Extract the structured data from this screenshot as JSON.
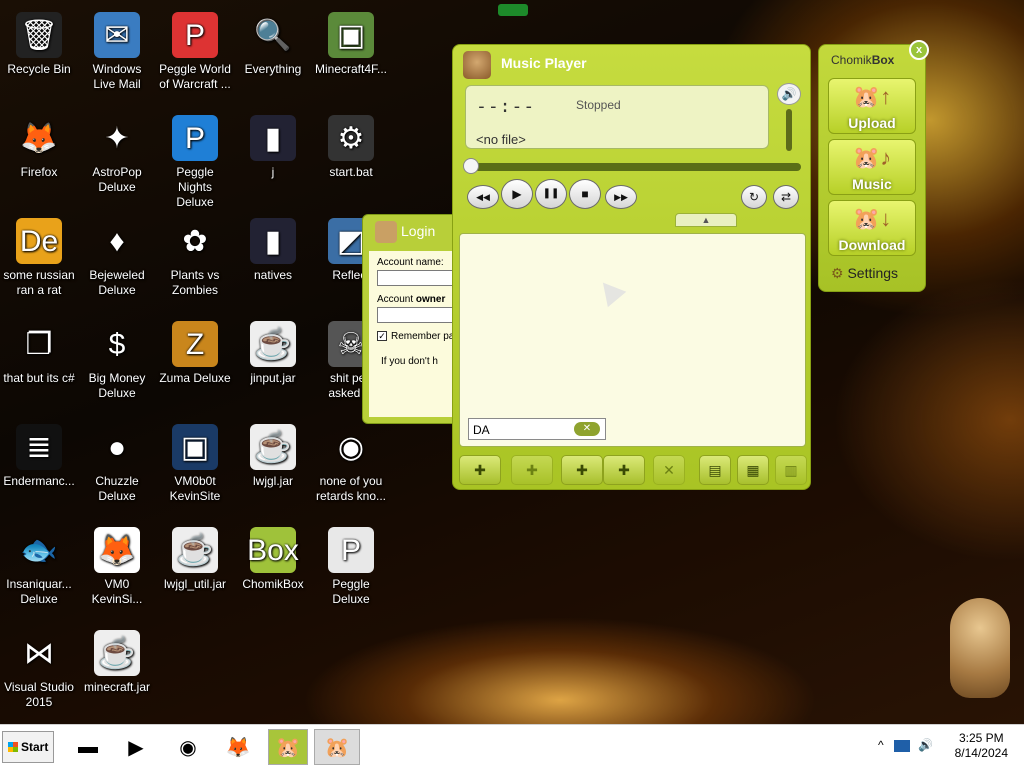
{
  "desktop_icons": [
    {
      "label": "Recycle Bin",
      "icon": "recycle-bin-icon",
      "glyph": "🗑",
      "bg": "#222"
    },
    {
      "label": "Windows Live Mail",
      "icon": "mail-icon",
      "glyph": "✉",
      "bg": "#3a7cc1"
    },
    {
      "label": "Peggle World of Warcraft ...",
      "icon": "peggle-icon",
      "glyph": "P",
      "bg": "#d33"
    },
    {
      "label": "Everything",
      "icon": "search-icon",
      "glyph": "🔍",
      "bg": "transparent"
    },
    {
      "label": "Minecraft4F...",
      "icon": "minecraft-icon",
      "glyph": "▣",
      "bg": "#5b8a3a"
    },
    {
      "label": "Firefox",
      "icon": "firefox-icon",
      "glyph": "🦊",
      "bg": "transparent"
    },
    {
      "label": "AstroPop Deluxe",
      "icon": "astropop-icon",
      "glyph": "✦",
      "bg": "transparent"
    },
    {
      "label": "Peggle Nights Deluxe",
      "icon": "peggle-nights-icon",
      "glyph": "P",
      "bg": "#1f7fd6"
    },
    {
      "label": "j",
      "icon": "folder-icon",
      "glyph": "▮",
      "bg": "#223"
    },
    {
      "label": "start.bat",
      "icon": "batch-file-icon",
      "glyph": "⚙",
      "bg": "#333"
    },
    {
      "label": "some russian ran a rat",
      "icon": "de-icon",
      "glyph": "De",
      "bg": "#e9a21a"
    },
    {
      "label": "Bejeweled Deluxe",
      "icon": "gem-icon",
      "glyph": "♦",
      "bg": "transparent"
    },
    {
      "label": "Plants vs Zombies",
      "icon": "pvz-icon",
      "glyph": "✿",
      "bg": "transparent"
    },
    {
      "label": "natives",
      "icon": "folder-icon",
      "glyph": "▮",
      "bg": "#223"
    },
    {
      "label": "Reflect",
      "icon": "reflect-icon",
      "glyph": "◩",
      "bg": "#3b6ea5"
    },
    {
      "label": "that but its c#",
      "icon": "copy-icon",
      "glyph": "❐",
      "bg": "transparent"
    },
    {
      "label": "Big Money Deluxe",
      "icon": "money-bag-icon",
      "glyph": "$",
      "bg": "transparent"
    },
    {
      "label": "Zuma Deluxe",
      "icon": "zuma-icon",
      "glyph": "Z",
      "bg": "#c9861c"
    },
    {
      "label": "jinput.jar",
      "icon": "jar-file-icon",
      "glyph": "☕",
      "bg": "#eee"
    },
    {
      "label": "shit ped asked m",
      "icon": "file-icon",
      "glyph": "☠",
      "bg": "#555"
    },
    {
      "label": "Endermanc...",
      "icon": "console-icon",
      "glyph": "≣",
      "bg": "#111"
    },
    {
      "label": "Chuzzle Deluxe",
      "icon": "chuzzle-icon",
      "glyph": "●",
      "bg": "transparent"
    },
    {
      "label": "VM0b0t KevinSite",
      "icon": "vm-icon",
      "glyph": "▣",
      "bg": "#1a3a66"
    },
    {
      "label": "lwjgl.jar",
      "icon": "jar-file-icon",
      "glyph": "☕",
      "bg": "#eee"
    },
    {
      "label": "none of you retards kno...",
      "icon": "dragon-icon",
      "glyph": "◉",
      "bg": "transparent"
    },
    {
      "label": "Insaniquar... Deluxe",
      "icon": "fish-icon",
      "glyph": "🐟",
      "bg": "transparent"
    },
    {
      "label": "VM0 KevinSi...",
      "icon": "firefox-file-icon",
      "glyph": "🦊",
      "bg": "#fff"
    },
    {
      "label": "lwjgl_util.jar",
      "icon": "jar-file-icon",
      "glyph": "☕",
      "bg": "#eee"
    },
    {
      "label": "ChomikBox",
      "icon": "chomikbox-icon",
      "glyph": "Box",
      "bg": "#9fc23a"
    },
    {
      "label": "Peggle Deluxe",
      "icon": "peggle-deluxe-icon",
      "glyph": "P",
      "bg": "#e8e8e8"
    },
    {
      "label": "Visual Studio 2015",
      "icon": "visual-studio-icon",
      "glyph": "⋈",
      "bg": "transparent"
    },
    {
      "label": "minecraft.jar",
      "icon": "jar-file-icon",
      "glyph": "☕",
      "bg": "#eee"
    }
  ],
  "login": {
    "title": "Login",
    "account_name_label": "Account name:",
    "account_owner_label_a": "Account ",
    "account_owner_label_b": "owner",
    "remember_label": "Remember pa",
    "checked": "✓",
    "hint": "If you don't h"
  },
  "player": {
    "title": "Music Player",
    "time": "--:--",
    "state": "Stopped",
    "file": "<no file>",
    "search_value": "DA",
    "clear_glyph": "✕",
    "volume_glyph": "🔊",
    "collapse_glyph": "▲",
    "controls": {
      "rewind": "◀◀",
      "play": "▶",
      "pause": "❚❚",
      "stop": "■",
      "forward": "▶▶",
      "repeat": "↻",
      "shuffle": "⇄"
    },
    "toolbar": [
      {
        "name": "add-user-button",
        "glyph": "✚"
      },
      {
        "name": "remove-button",
        "glyph": "✚"
      },
      {
        "name": "add-file-button",
        "glyph": "✚"
      },
      {
        "name": "add-folder-button",
        "glyph": "✚"
      },
      {
        "name": "remove-item-button",
        "glyph": "✕"
      },
      {
        "name": "playlist-button",
        "glyph": "▤"
      },
      {
        "name": "save-playlist-button",
        "glyph": "▦"
      },
      {
        "name": "export-button",
        "glyph": "▥"
      }
    ]
  },
  "chomikbox": {
    "title_a": "Chomik",
    "title_b": "Box",
    "close_glyph": "x",
    "upload": "Upload",
    "music": "Music",
    "download": "Download",
    "settings": "Settings",
    "gear_glyph": "⚙"
  },
  "taskbar": {
    "start": "Start",
    "time": "3:25 PM",
    "date": "8/14/2024",
    "tray_up": "^"
  }
}
